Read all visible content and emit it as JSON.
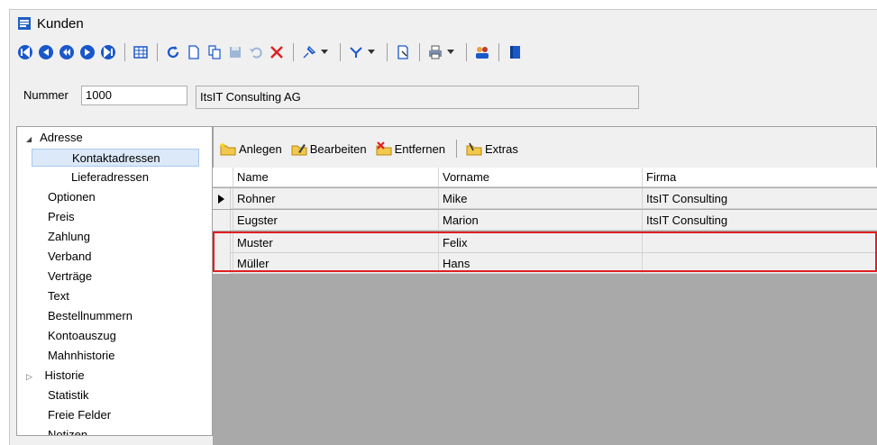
{
  "window": {
    "title": "Kunden"
  },
  "toolbar": {
    "icons": [
      "first-icon",
      "prev-page-icon",
      "prev-icon",
      "next-icon",
      "last-icon",
      "table-view-icon",
      "refresh-icon",
      "new-icon",
      "copy-icon",
      "save-icon",
      "undo-icon",
      "delete-icon",
      "pin-icon",
      "filter-icon",
      "export-icon",
      "print-icon",
      "contacts-icon",
      "book-icon"
    ]
  },
  "header": {
    "nummer_label": "Nummer",
    "nummer_value": "1000",
    "firma_value": "ItsIT Consulting AG"
  },
  "nav": {
    "items": [
      {
        "label": "Adresse",
        "expander": "◢"
      },
      {
        "label": "Kontaktadressen"
      },
      {
        "label": "Lieferadressen"
      },
      {
        "label": "Optionen"
      },
      {
        "label": "Preis"
      },
      {
        "label": "Zahlung"
      },
      {
        "label": "Verband"
      },
      {
        "label": "Verträge"
      },
      {
        "label": "Text"
      },
      {
        "label": "Bestellnummern"
      },
      {
        "label": "Kontoauszug"
      },
      {
        "label": "Mahnhistorie"
      },
      {
        "label": "Historie",
        "expander": "▷"
      },
      {
        "label": "Statistik"
      },
      {
        "label": "Freie Felder"
      },
      {
        "label": "Notizen"
      }
    ]
  },
  "grid_toolbar": {
    "anlegen": "Anlegen",
    "bearbeiten": "Bearbeiten",
    "entfernen": "Entfernen",
    "extras": "Extras"
  },
  "grid": {
    "columns": [
      "Name",
      "Vorname",
      "Firma"
    ],
    "rows": [
      {
        "name": "Rohner",
        "vorname": "Mike",
        "firma": "ItsIT Consulting",
        "current": true
      },
      {
        "name": "Eugster",
        "vorname": "Marion",
        "firma": "ItsIT Consulting"
      },
      {
        "name": "Muster",
        "vorname": "Felix",
        "firma": ""
      },
      {
        "name": "Müller",
        "vorname": "Hans",
        "firma": ""
      }
    ]
  },
  "colors": {
    "highlight": "#e02020",
    "selection": "#dbe9f8",
    "accent": "#1f5fbf"
  }
}
